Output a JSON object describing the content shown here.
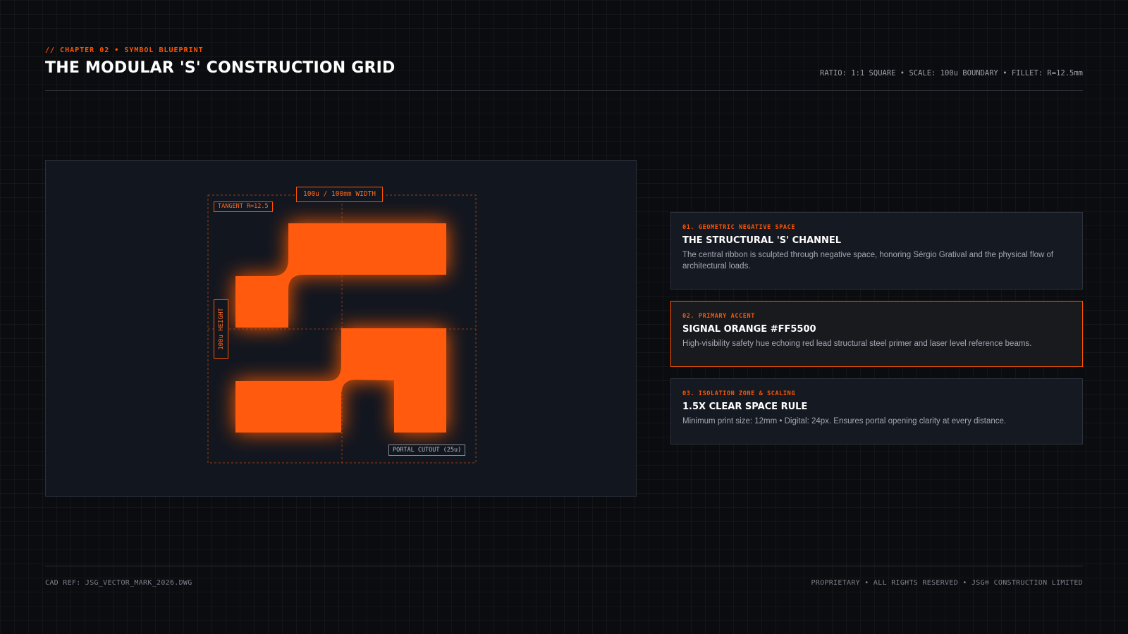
{
  "header": {
    "kicker": "// CHAPTER 02 • SYMBOL BLUEPRINT",
    "title": "THE MODULAR 'S' CONSTRUCTION GRID",
    "spec": "RATIO: 1:1 SQUARE • SCALE: 100u BOUNDARY • FILLET: R=12.5mm"
  },
  "canvas": {
    "width_label": "100u / 100mm WIDTH",
    "tangent_label": "TANGENT R=12.5",
    "height_label": "100u HEIGHT",
    "portal_label": "PORTAL CUTOUT (25u)"
  },
  "cards": [
    {
      "kicker": "01. GEOMETRIC NEGATIVE SPACE",
      "title": "THE STRUCTURAL 'S' CHANNEL",
      "body": "The central ribbon is sculpted through negative space, honoring Sérgio Gratival and the physical flow of architectural loads."
    },
    {
      "kicker": "02. PRIMARY ACCENT",
      "title": "SIGNAL ORANGE #FF5500",
      "body": "High-visibility safety hue echoing red lead structural steel primer and laser level reference beams."
    },
    {
      "kicker": "03. ISOLATION ZONE & SCALING",
      "title": "1.5X CLEAR SPACE RULE",
      "body": "Minimum print size: 12mm • Digital: 24px. Ensures portal opening clarity at every distance."
    }
  ],
  "footer": {
    "left": "CAD REF: JSG_VECTOR_MARK_2026.DWG",
    "right": "PROPRIETARY • ALL RIGHTS RESERVED • JSG® CONSTRUCTION LIMITED"
  },
  "colors": {
    "accent": "#FF5500",
    "background": "#0B0C0F",
    "panel": "#12161F"
  },
  "icons": {
    "mark": "jsg-s-mark-icon"
  }
}
